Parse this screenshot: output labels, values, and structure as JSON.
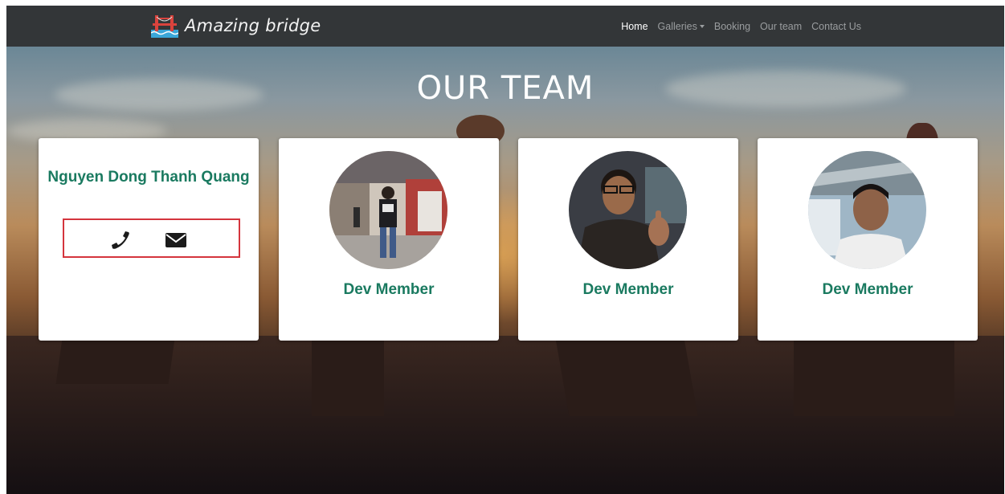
{
  "navbar": {
    "brand": "Amazing bridge",
    "links": [
      {
        "label": "Home",
        "active": true
      },
      {
        "label": "Galleries",
        "dropdown": true
      },
      {
        "label": "Booking"
      },
      {
        "label": "Our team"
      },
      {
        "label": "Contact Us"
      }
    ]
  },
  "hero": {
    "title": "OUR TEAM"
  },
  "team": [
    {
      "name": "Nguyen Dong Thanh Quang",
      "contacts": [
        "phone-icon",
        "envelope-icon"
      ]
    },
    {
      "role": "Dev Member"
    },
    {
      "role": "Dev Member"
    },
    {
      "role": "Dev Member"
    }
  ],
  "colors": {
    "navbar_bg": "#333638",
    "accent_text": "#1a7a60",
    "highlight_border": "#d4353d"
  }
}
